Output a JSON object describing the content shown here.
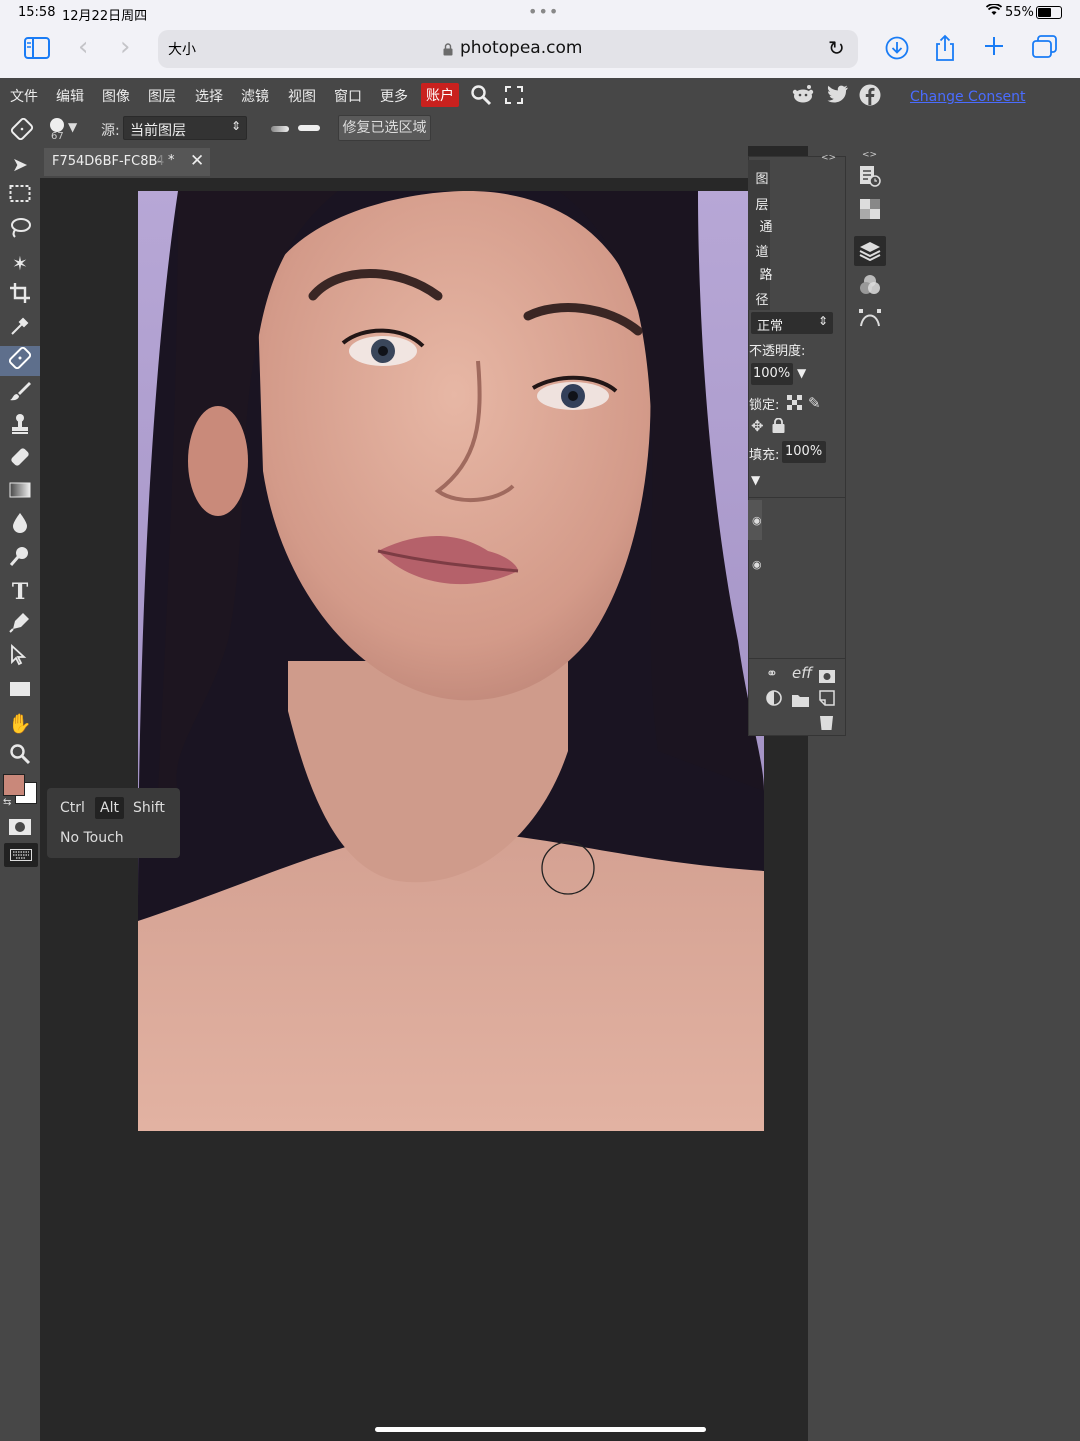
{
  "status": {
    "time": "15:58",
    "date": "12月22日周四",
    "battery": "55%"
  },
  "safari": {
    "text_size_label": "大小",
    "url": "photopea.com"
  },
  "menu": {
    "items": [
      "文件",
      "编辑",
      "图像",
      "图层",
      "选择",
      "滤镜",
      "视图",
      "窗口",
      "更多"
    ],
    "account": "账户",
    "consent": "Change Consent"
  },
  "options": {
    "brush_size": "67",
    "source_label": "源:",
    "source_value": "当前图层",
    "heal_button": "修复已选区域"
  },
  "document": {
    "tab_title": "F754D6BF-FC8B-",
    "tab_dim": "4",
    "modified": "*"
  },
  "panels": {
    "tab_layers": [
      "图",
      "层"
    ],
    "tab_channels": [
      "通",
      "道"
    ],
    "tab_paths": [
      "路",
      "径"
    ],
    "blend_mode": "正常",
    "opacity_label": "不透明度:",
    "opacity_value": "100%",
    "lock_label": "锁定:",
    "fill_label": "填充:",
    "fill_value": "100%",
    "eff_label": "eff"
  },
  "modifiers": {
    "ctrl": "Ctrl",
    "alt": "Alt",
    "shift": "Shift",
    "touch": "No Touch"
  },
  "colors": {
    "foreground": "#c9887a",
    "background": "#ffffff",
    "account_red": "#c9211e"
  },
  "icons": [
    "sidebar-icon",
    "back-icon",
    "forward-icon",
    "lock-icon",
    "reload-icon",
    "download-icon",
    "share-icon",
    "plus-icon",
    "tabs-icon",
    "search-icon",
    "fullscreen-icon",
    "reddit-icon",
    "twitter-icon",
    "facebook-icon"
  ]
}
